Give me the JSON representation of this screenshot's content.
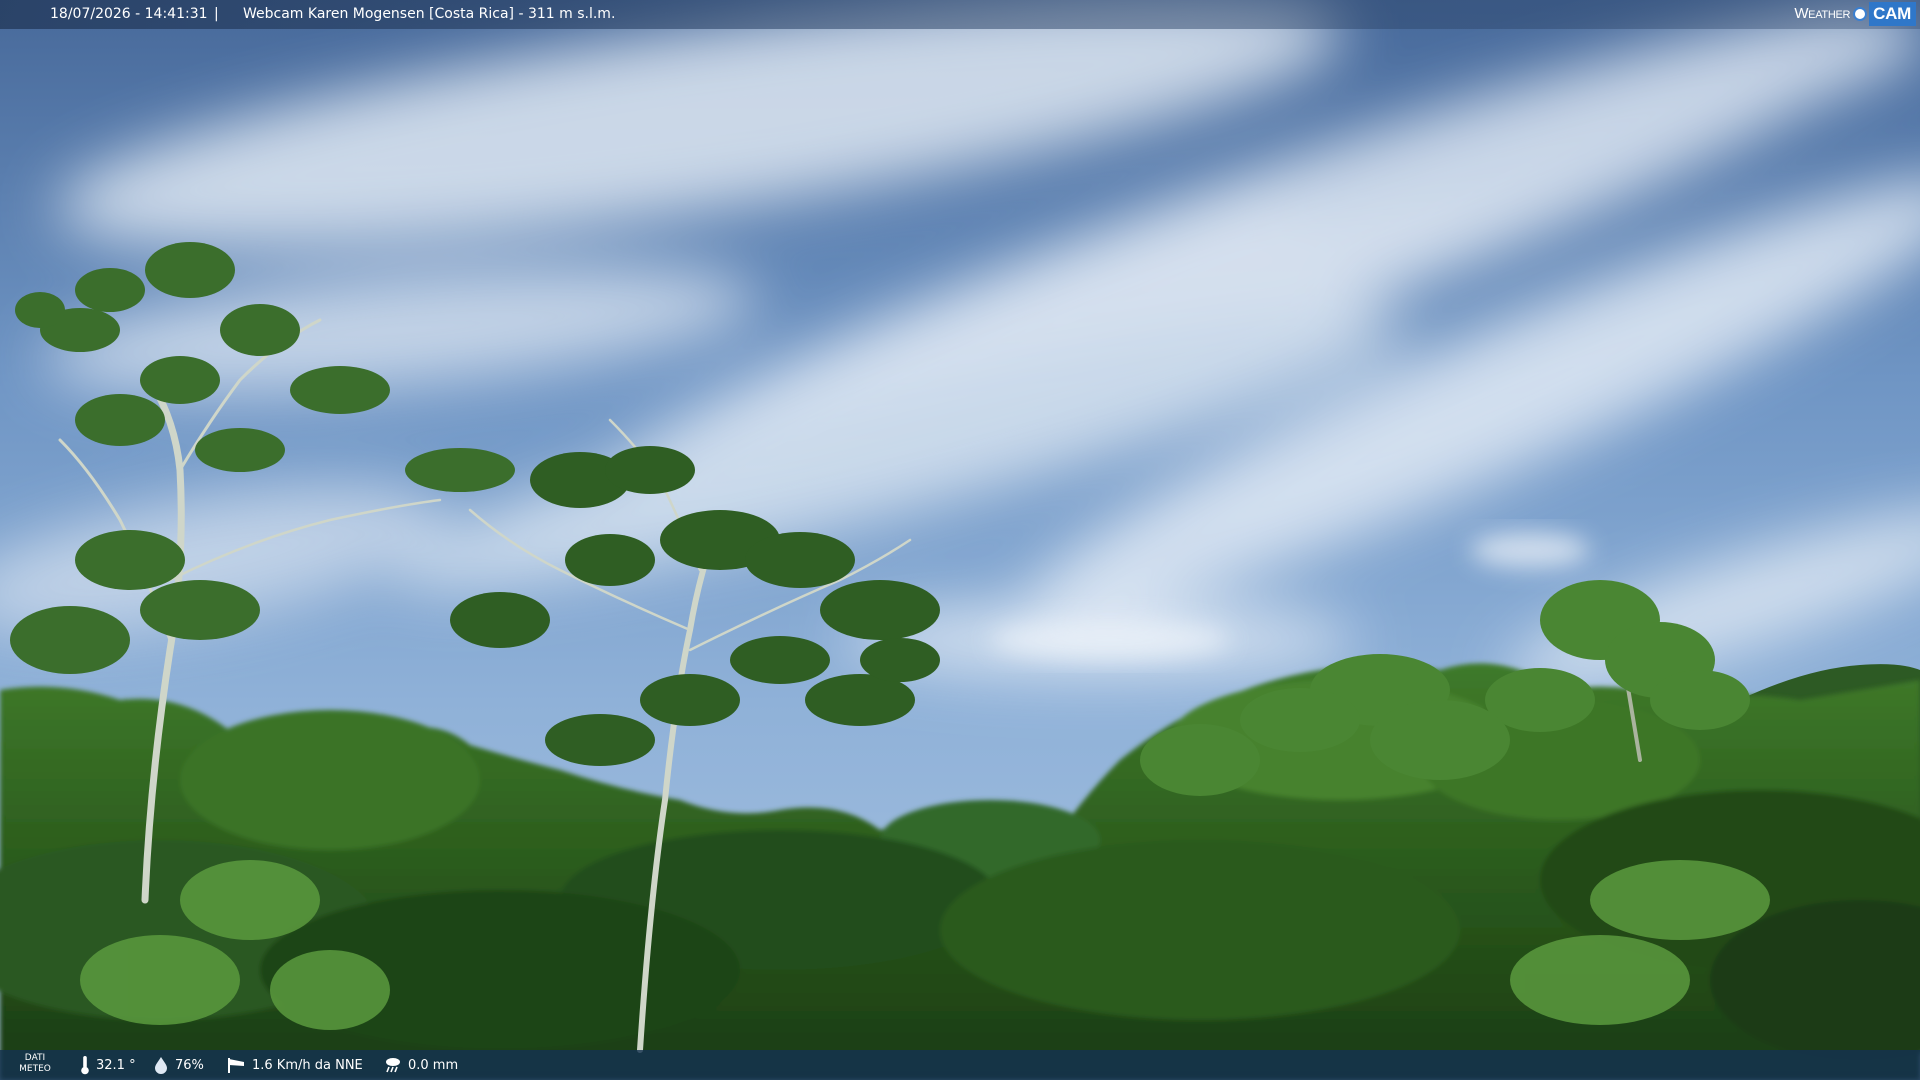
{
  "header": {
    "timestamp": "18/07/2026 - 14:41:31",
    "separator": "|",
    "title": "Webcam Karen Mogensen [Costa Rica]  - 311 m s.l.m.",
    "brand_left": "Weather",
    "brand_right": "CAM"
  },
  "weather_bar": {
    "badge_line1": "DATI",
    "badge_line2": "METEO",
    "temperature": "32.1 °",
    "humidity": "76%",
    "wind": "1.6 Km/h da NNE",
    "rain": "0.0 mm"
  },
  "icons": {
    "temperature": "thermometer-icon",
    "humidity": "droplet-icon",
    "wind": "windsock-icon",
    "rain": "rain-cloud-icon"
  },
  "colors": {
    "sky_top": "#4d78b0",
    "sky_mid": "#8db0d6",
    "cloud": "#e6eef7",
    "foliage_dark": "#1c3d14",
    "foliage_light": "#4c8a32",
    "brand_accent": "#2f77c9"
  }
}
